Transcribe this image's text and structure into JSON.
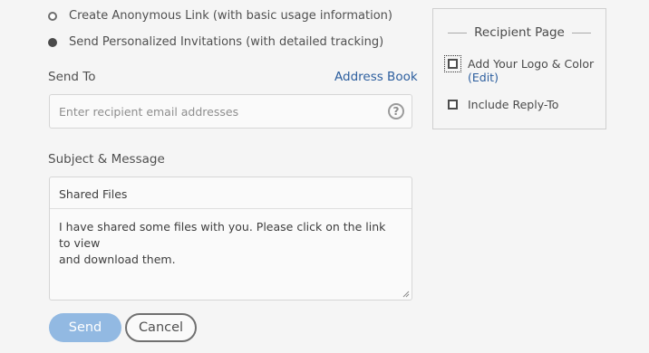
{
  "options": {
    "anonymous_link": "Create Anonymous Link (with basic usage information)",
    "personalized": "Send Personalized Invitations (with detailed tracking)"
  },
  "send_to": {
    "label": "Send To",
    "address_book": "Address Book",
    "placeholder": "Enter recipient email addresses",
    "help": "?"
  },
  "message": {
    "label": "Subject & Message",
    "subject": "Shared Files",
    "body_line1": "I have shared some files with you. Please click on the link to view",
    "body_line2": "and download them."
  },
  "buttons": {
    "send": "Send",
    "cancel": "Cancel"
  },
  "recipient_page": {
    "title": "Recipient Page",
    "add_logo": "Add Your Logo & Color",
    "edit": "(Edit)",
    "include_reply_to": "Include Reply-To"
  },
  "colors": {
    "accent_link": "#2c5e9e",
    "send_button": "#92b9e2"
  }
}
